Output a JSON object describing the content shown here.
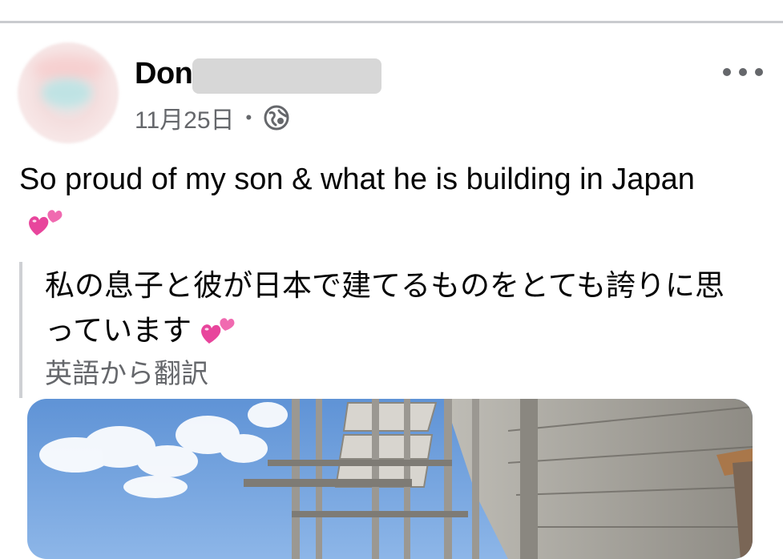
{
  "post": {
    "author_name": "Don",
    "date": "11月25日",
    "separator": "•",
    "privacy_icon": "globe-icon",
    "more_icon": "more-options-icon",
    "text": "So proud of my son & what he is building in Japan",
    "emoji": "two-hearts",
    "translation_text": "私の息子と彼が日本で建てるものをとても誇りに思っています",
    "translation_source": "英語から翻訳",
    "photo": "construction-scaffolding-photo"
  },
  "colors": {
    "divider": "#c9cbcf",
    "secondary_text": "#65676b",
    "primary_text": "#050505",
    "quote_bar": "#ced0d4",
    "heart_pink": "#e8459c",
    "sky_blue": "#6f9fdc"
  }
}
